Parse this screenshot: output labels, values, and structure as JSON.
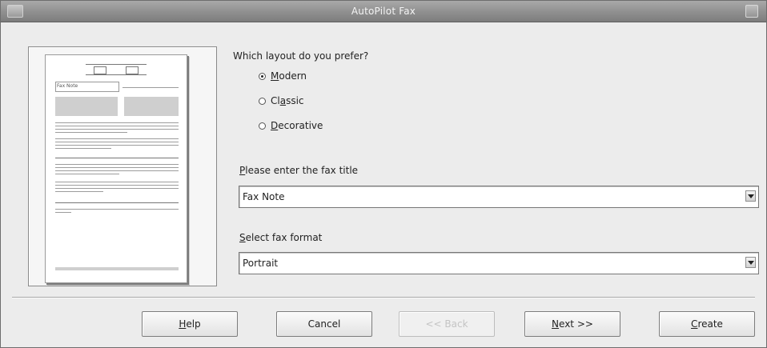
{
  "window": {
    "title": "AutoPilot Fax"
  },
  "preview": {
    "fax_label": "Fax Note"
  },
  "layout": {
    "question": "Which layout do you prefer?",
    "options": [
      {
        "first": "M",
        "rest": "odern",
        "selected": true
      },
      {
        "first": "Cl",
        "u": "a",
        "rest": "ssic",
        "selected": false
      },
      {
        "first": "",
        "u": "D",
        "rest": "ecorative",
        "selected": false
      }
    ]
  },
  "title_field": {
    "label_u": "P",
    "label_rest": "lease enter the fax title",
    "value": "Fax Note"
  },
  "format_field": {
    "label_u": "S",
    "label_rest": "elect fax format",
    "value": "Portrait"
  },
  "buttons": {
    "help_u": "H",
    "help_rest": "elp",
    "cancel": "Cancel",
    "back": "<< Back",
    "next_u": "N",
    "next_rest": "ext >>",
    "create_u": "C",
    "create_rest": "reate"
  }
}
